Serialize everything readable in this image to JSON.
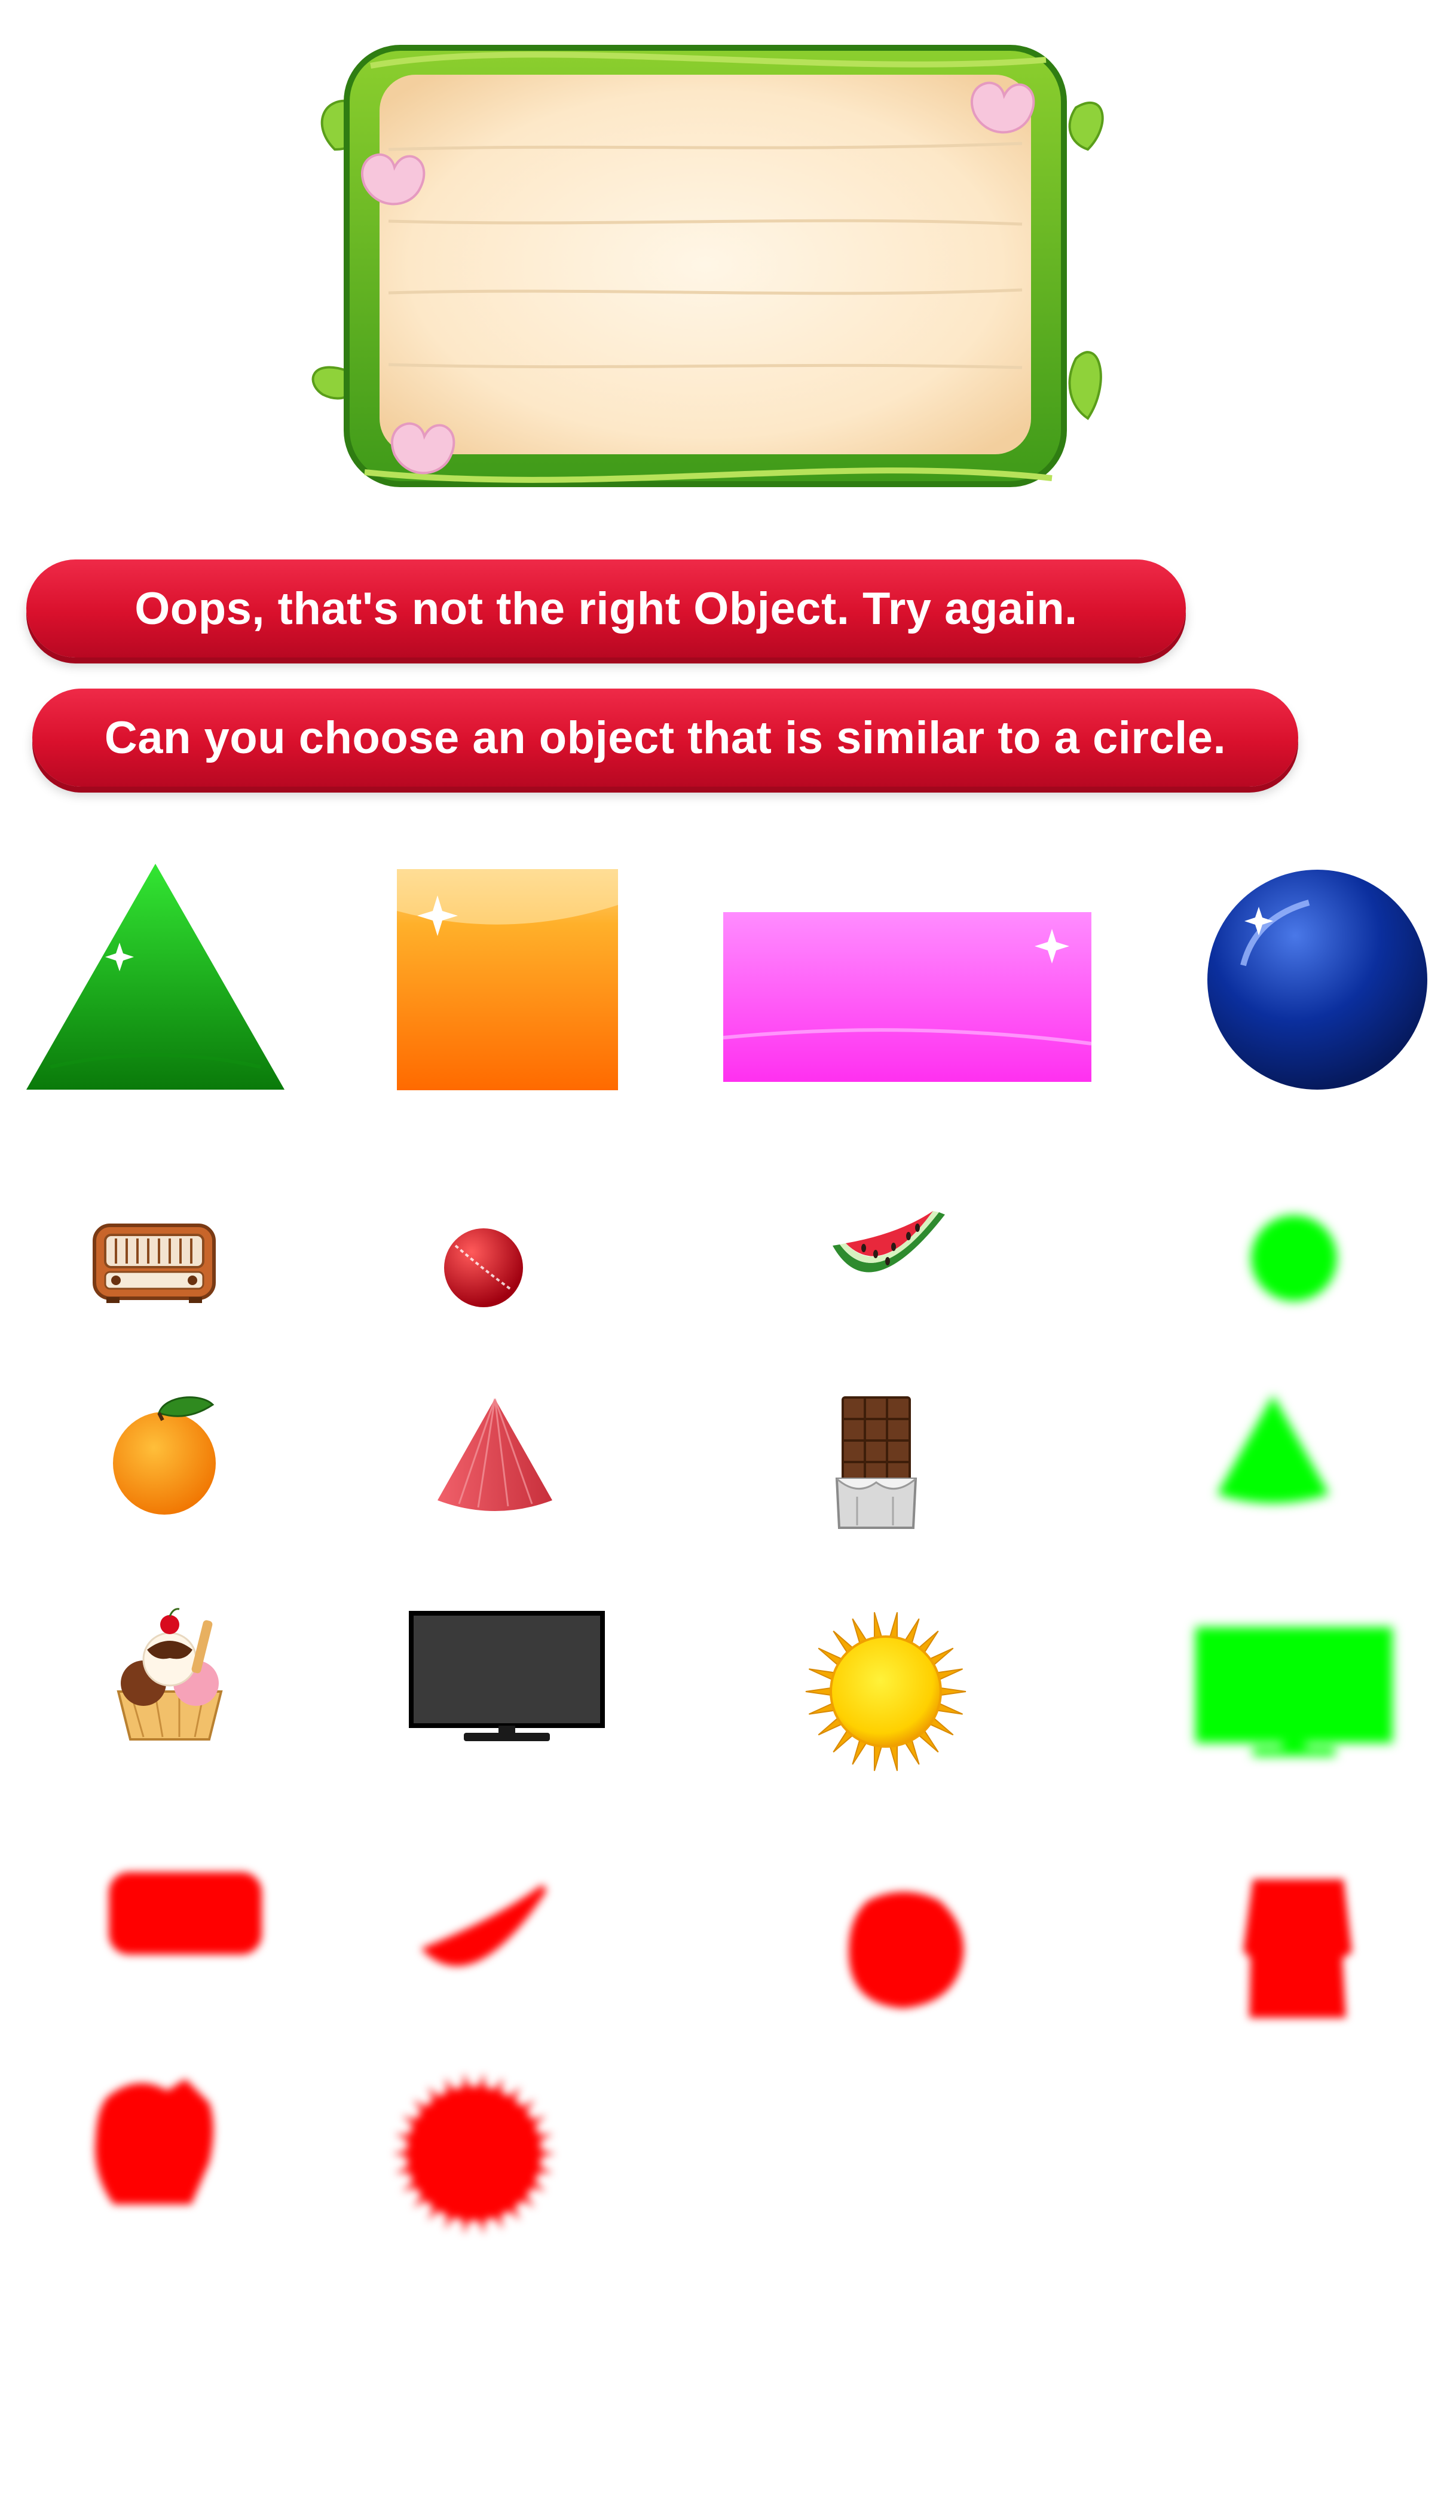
{
  "messages": {
    "feedback": "Oops, that's not the right Object. Try again.",
    "question": "Can you choose an object that is similar to a circle."
  },
  "colors": {
    "pill_red": "#d9102c",
    "hint_green": "#00ff00",
    "silhouette_red": "#ff0000"
  },
  "shapes": [
    {
      "name": "triangle",
      "color": "#0aa10a"
    },
    {
      "name": "square",
      "color": "#ff9a1a"
    },
    {
      "name": "rectangle",
      "color": "#ff5cf0"
    },
    {
      "name": "sphere",
      "color": "#0b2f9e"
    }
  ],
  "objects": [
    {
      "name": "radio-icon"
    },
    {
      "name": "cricket-ball-icon"
    },
    {
      "name": "watermelon-slice-icon"
    },
    {
      "name": "green-circle-hint"
    },
    {
      "name": "orange-icon"
    },
    {
      "name": "party-hat-cone-icon"
    },
    {
      "name": "chocolate-bar-icon"
    },
    {
      "name": "green-cone-hint"
    },
    {
      "name": "ice-cream-icon"
    },
    {
      "name": "television-icon"
    },
    {
      "name": "sun-icon"
    },
    {
      "name": "green-tv-hint"
    }
  ],
  "silhouettes": [
    {
      "name": "radio-silhouette"
    },
    {
      "name": "watermelon-silhouette"
    },
    {
      "name": "orange-silhouette"
    },
    {
      "name": "chocolate-silhouette"
    },
    {
      "name": "ice-cream-silhouette"
    },
    {
      "name": "sun-silhouette"
    }
  ]
}
